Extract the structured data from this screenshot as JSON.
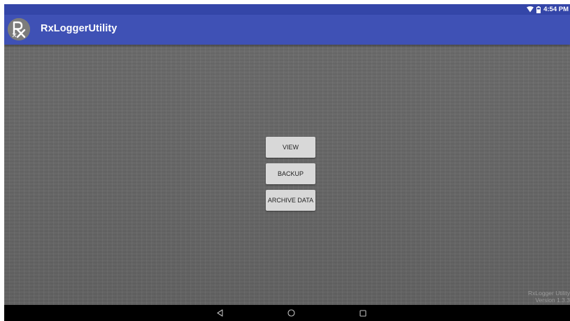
{
  "status_bar": {
    "time": "4:54 PM",
    "icons": [
      "wifi-icon",
      "battery-icon"
    ]
  },
  "app_bar": {
    "title": "RxLoggerUtility",
    "logo_icon": "rx-logo-icon",
    "logo_text": "Rx"
  },
  "actions": {
    "view_label": "VIEW",
    "backup_label": "BACKUP",
    "archive_label": "ARCHIVE DATA"
  },
  "footer": {
    "app_name": "RxLogger Utility",
    "version": "Version 1.3.3"
  },
  "nav_bar": {
    "icons": [
      "back-icon",
      "home-icon",
      "recents-icon"
    ]
  },
  "colors": {
    "status_bar": "#3446a8",
    "app_bar": "#3f51b5",
    "button": "#d8d8d8",
    "background": "#666666"
  }
}
